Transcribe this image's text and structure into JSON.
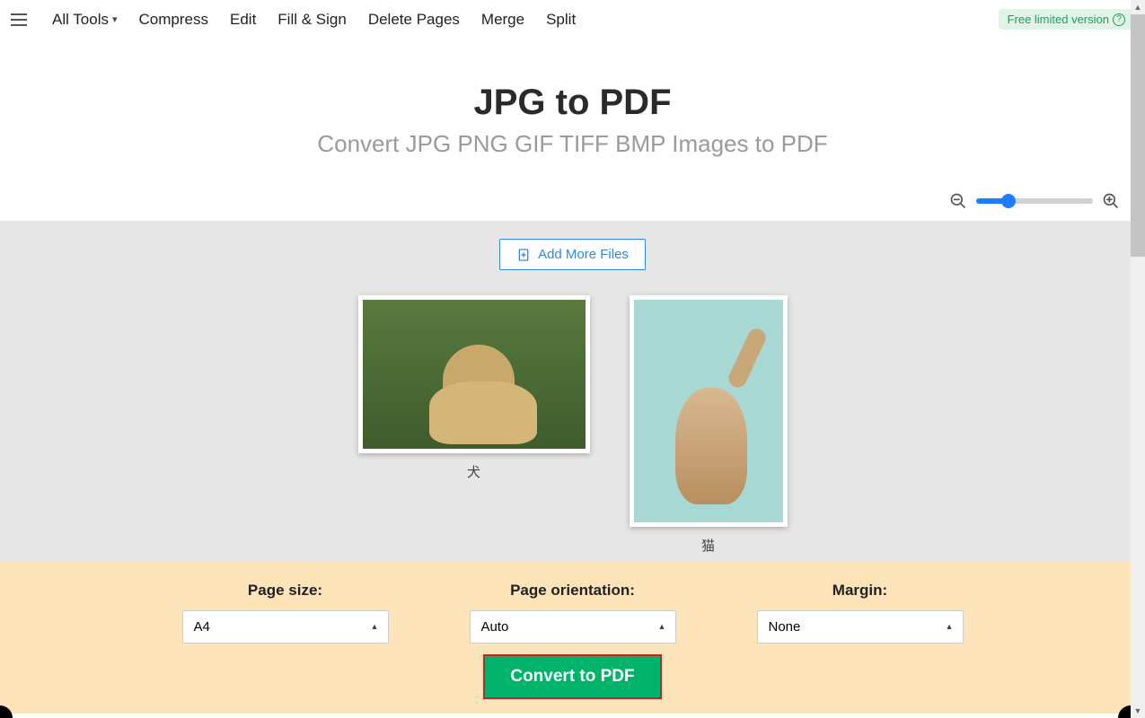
{
  "nav": {
    "all_tools": "All Tools",
    "compress": "Compress",
    "edit": "Edit",
    "fill_sign": "Fill & Sign",
    "delete_pages": "Delete Pages",
    "merge": "Merge",
    "split": "Split"
  },
  "badge": {
    "text": "Free limited version"
  },
  "hero": {
    "title": "JPG to PDF",
    "subtitle": "Convert JPG PNG GIF TIFF BMP Images to PDF"
  },
  "actions": {
    "add_more": "Add More Files"
  },
  "files": [
    {
      "label": "犬",
      "orientation": "landscape"
    },
    {
      "label": "猫",
      "orientation": "portrait"
    }
  ],
  "options": {
    "page_size": {
      "label": "Page size:",
      "value": "A4"
    },
    "orientation": {
      "label": "Page orientation:",
      "value": "Auto"
    },
    "margin": {
      "label": "Margin:",
      "value": "None"
    }
  },
  "convert": {
    "label": "Convert to PDF"
  }
}
